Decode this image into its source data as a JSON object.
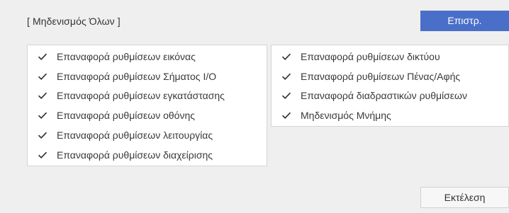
{
  "title": "[ Μηδενισμός Όλων ]",
  "back_button": "Επιστρ.",
  "execute_button": "Εκτέλεση",
  "left_options": [
    {
      "label": "Επαναφορά ρυθμίσεων εικόνας",
      "checked": true
    },
    {
      "label": "Επαναφορά ρυθμίσεων Σήματος I/O",
      "checked": true
    },
    {
      "label": "Επαναφορά ρυθμίσεων εγκατάστασης",
      "checked": true
    },
    {
      "label": "Επαναφορά ρυθμίσεων οθόνης",
      "checked": true
    },
    {
      "label": "Επαναφορά ρυθμίσεων λειτουργίας",
      "checked": true
    },
    {
      "label": "Επαναφορά ρυθμίσεων διαχείρισης",
      "checked": true
    }
  ],
  "right_options": [
    {
      "label": "Επαναφορά ρυθμίσεων δικτύου",
      "checked": true
    },
    {
      "label": "Επαναφορά ρυθμίσεων Πένας/Αφής",
      "checked": true
    },
    {
      "label": "Επαναφορά διαδραστικών ρυθμίσεων",
      "checked": true
    },
    {
      "label": "Μηδενισμός Μνήμης",
      "checked": true
    }
  ],
  "colors": {
    "accent": "#4a6fc8",
    "background": "#efefef",
    "panel": "#ffffff",
    "check": "#333333"
  },
  "icons": {
    "check": "checkmark-icon"
  }
}
